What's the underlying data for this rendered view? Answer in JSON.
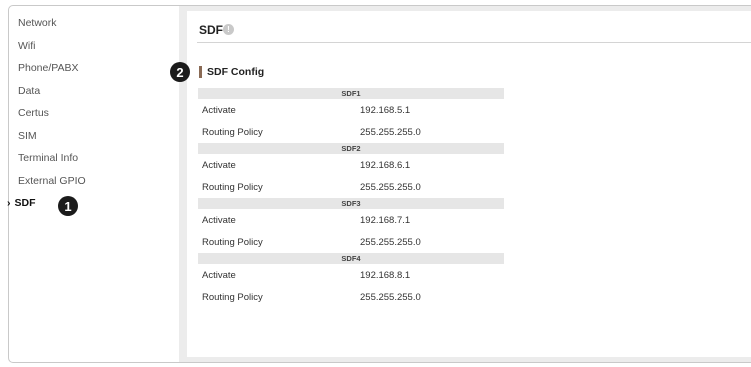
{
  "sidebar": {
    "items": [
      {
        "label": "Network"
      },
      {
        "label": "Wifi"
      },
      {
        "label": "Phone/PABX"
      },
      {
        "label": "Data"
      },
      {
        "label": "Certus"
      },
      {
        "label": "SIM"
      },
      {
        "label": "Terminal Info"
      },
      {
        "label": "External GPIO"
      },
      {
        "label": "SDF",
        "active": true
      }
    ],
    "chevron": "›"
  },
  "callouts": {
    "one": "1",
    "two": "2"
  },
  "page": {
    "title": "SDF",
    "info_icon": "!"
  },
  "section": {
    "title": "SDF Config"
  },
  "sdf_groups": [
    {
      "name": "SDF1",
      "activate_label": "Activate",
      "activate_value": "192.168.5.1",
      "routing_label": "Routing Policy",
      "routing_value": "255.255.255.0"
    },
    {
      "name": "SDF2",
      "activate_label": "Activate",
      "activate_value": "192.168.6.1",
      "routing_label": "Routing Policy",
      "routing_value": "255.255.255.0"
    },
    {
      "name": "SDF3",
      "activate_label": "Activate",
      "activate_value": "192.168.7.1",
      "routing_label": "Routing Policy",
      "routing_value": "255.255.255.0"
    },
    {
      "name": "SDF4",
      "activate_label": "Activate",
      "activate_value": "192.168.8.1",
      "routing_label": "Routing Policy",
      "routing_value": "255.255.255.0"
    }
  ]
}
